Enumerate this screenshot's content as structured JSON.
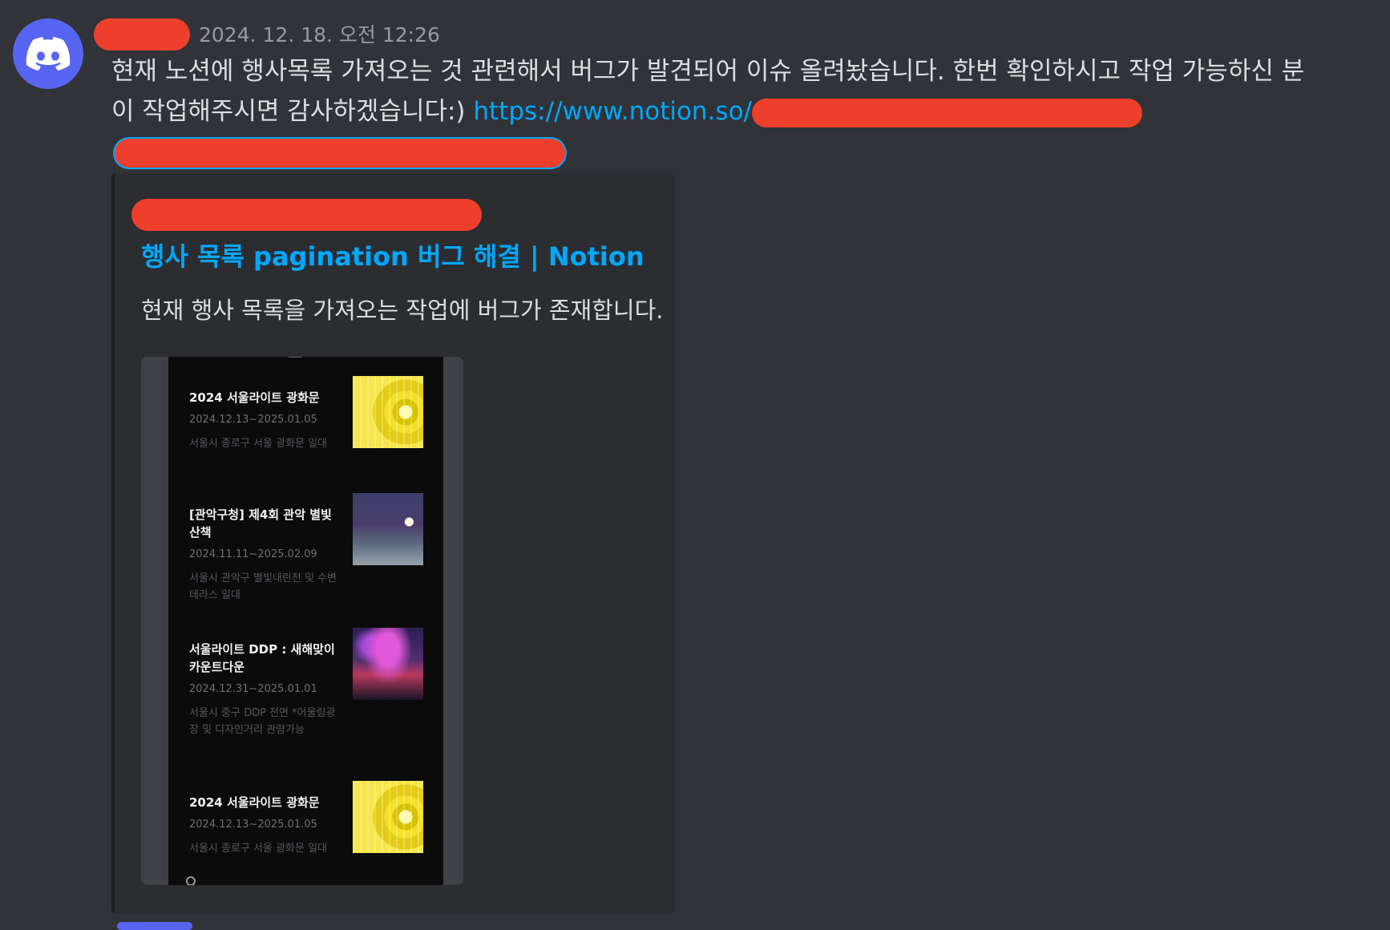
{
  "message": {
    "timestamp": "2024. 12. 18. 오전 12:26",
    "line1": "현재 노션에 행사목록 가져오는 것 관련해서 버그가 발견되어 이슈 올려놨습니다. 한번 확인하시고 작업 가능하신 분",
    "line2_text": "이 작업해주시면 감사하겠습니다:) ",
    "link_visible": "https://www.notion.so/"
  },
  "embed": {
    "title": "행사 목록 pagination 버그 해결 | Notion",
    "description": "현재 행사 목록을 가져오는 작업에 버그가 존재합니다.",
    "events": [
      {
        "title": "2024 서울라이트 광화문",
        "date": "2024.12.13~2025.01.05",
        "location": "서울시 종로구 서울 광화문 일대",
        "thumb": "yellow"
      },
      {
        "title": "[관악구청] 제4회 관악 별빛 산책",
        "date": "2024.11.11~2025.02.09",
        "location": "서울시 관악구 별빛내린천 및 수변테라스 일대",
        "thumb": "night"
      },
      {
        "title": "서울라이트 DDP : 새해맞이 카운트다운",
        "date": "2024.12.31~2025.01.01",
        "location": "서울시 중구 DDP 전면 *어울림광장 및 디자인거리 관람가능",
        "thumb": "fire"
      },
      {
        "title": "2024 서울라이트 광화문",
        "date": "2024.12.13~2025.01.05",
        "location": "서울시 종로구 서울 광화문 일대",
        "thumb": "yellow"
      }
    ]
  },
  "colors": {
    "background": "#313338",
    "link": "#00a8fc",
    "redaction": "#ee3f2c",
    "avatar": "#5865f2"
  },
  "icons": {
    "avatar": "discord-logo-icon"
  }
}
